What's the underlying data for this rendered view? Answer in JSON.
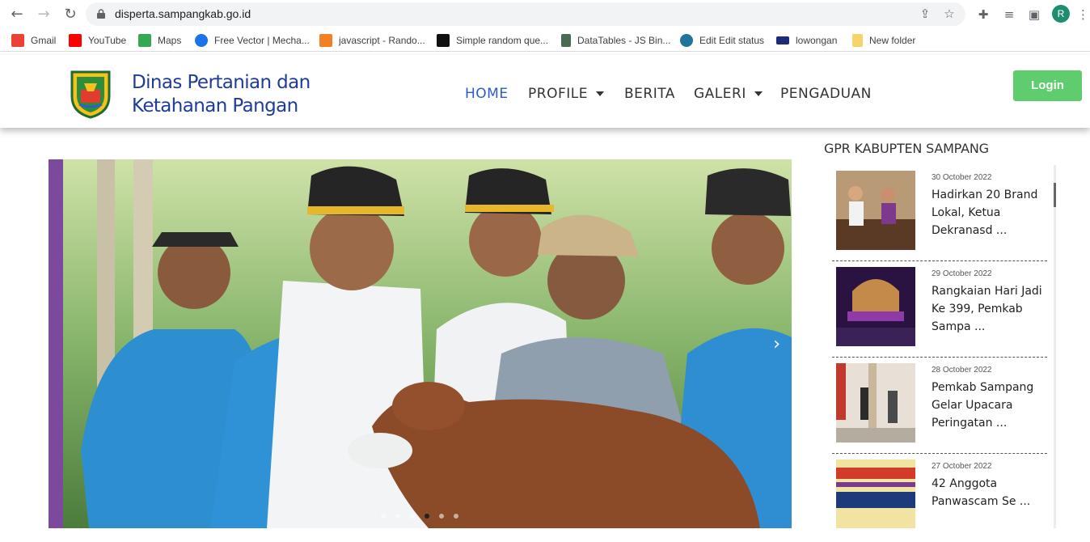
{
  "browser": {
    "url": "disperta.sampangkab.go.id",
    "profile_initial": "R",
    "bookmarks": [
      {
        "label": "Gmail",
        "color": "#ea4335"
      },
      {
        "label": "YouTube",
        "color": "#ff0000"
      },
      {
        "label": "Maps",
        "color": "#34a853"
      },
      {
        "label": "Free Vector | Mecha...",
        "color": "#1a73e8"
      },
      {
        "label": "javascript - Rando...",
        "color": "#f48024"
      },
      {
        "label": "Simple random que...",
        "color": "#111111"
      },
      {
        "label": "DataTables - JS Bin...",
        "color": "#4a6b52"
      },
      {
        "label": "Edit Edit status",
        "color": "#21759b"
      },
      {
        "label": "lowongan",
        "color": "#1f2a7a"
      },
      {
        "label": "New folder",
        "color": "#f6d36b"
      }
    ]
  },
  "site": {
    "brand_line1": "Dinas Pertanian dan",
    "brand_line2": "Ketahanan Pangan",
    "menu": [
      {
        "label": "HOME",
        "active": true,
        "dropdown": false
      },
      {
        "label": "PROFILE",
        "active": false,
        "dropdown": true
      },
      {
        "label": "BERITA",
        "active": false,
        "dropdown": false
      },
      {
        "label": "GALERI",
        "active": false,
        "dropdown": true
      },
      {
        "label": "PENGADUAN",
        "active": false,
        "dropdown": false
      }
    ],
    "login_label": "Login",
    "accent_color": "#2a5bd7",
    "login_color": "#5fcd6d"
  },
  "slider": {
    "next_icon": "chevron-right-icon",
    "dot_count": 6,
    "active_dot": 4
  },
  "sidebar": {
    "title": "GPR KABUPTEN SAMPANG",
    "news": [
      {
        "date": "30 October 2022",
        "title": "Hadirkan 20 Brand Lokal, Ketua Dekranasd ..."
      },
      {
        "date": "29 October 2022",
        "title": "Rangkaian Hari Jadi Ke 399, Pemkab Sampa ..."
      },
      {
        "date": "28 October 2022",
        "title": "Pemkab Sampang Gelar Upacara Peringatan ..."
      },
      {
        "date": "27 October 2022",
        "title": "42 Anggota Panwascam Se ..."
      }
    ]
  }
}
